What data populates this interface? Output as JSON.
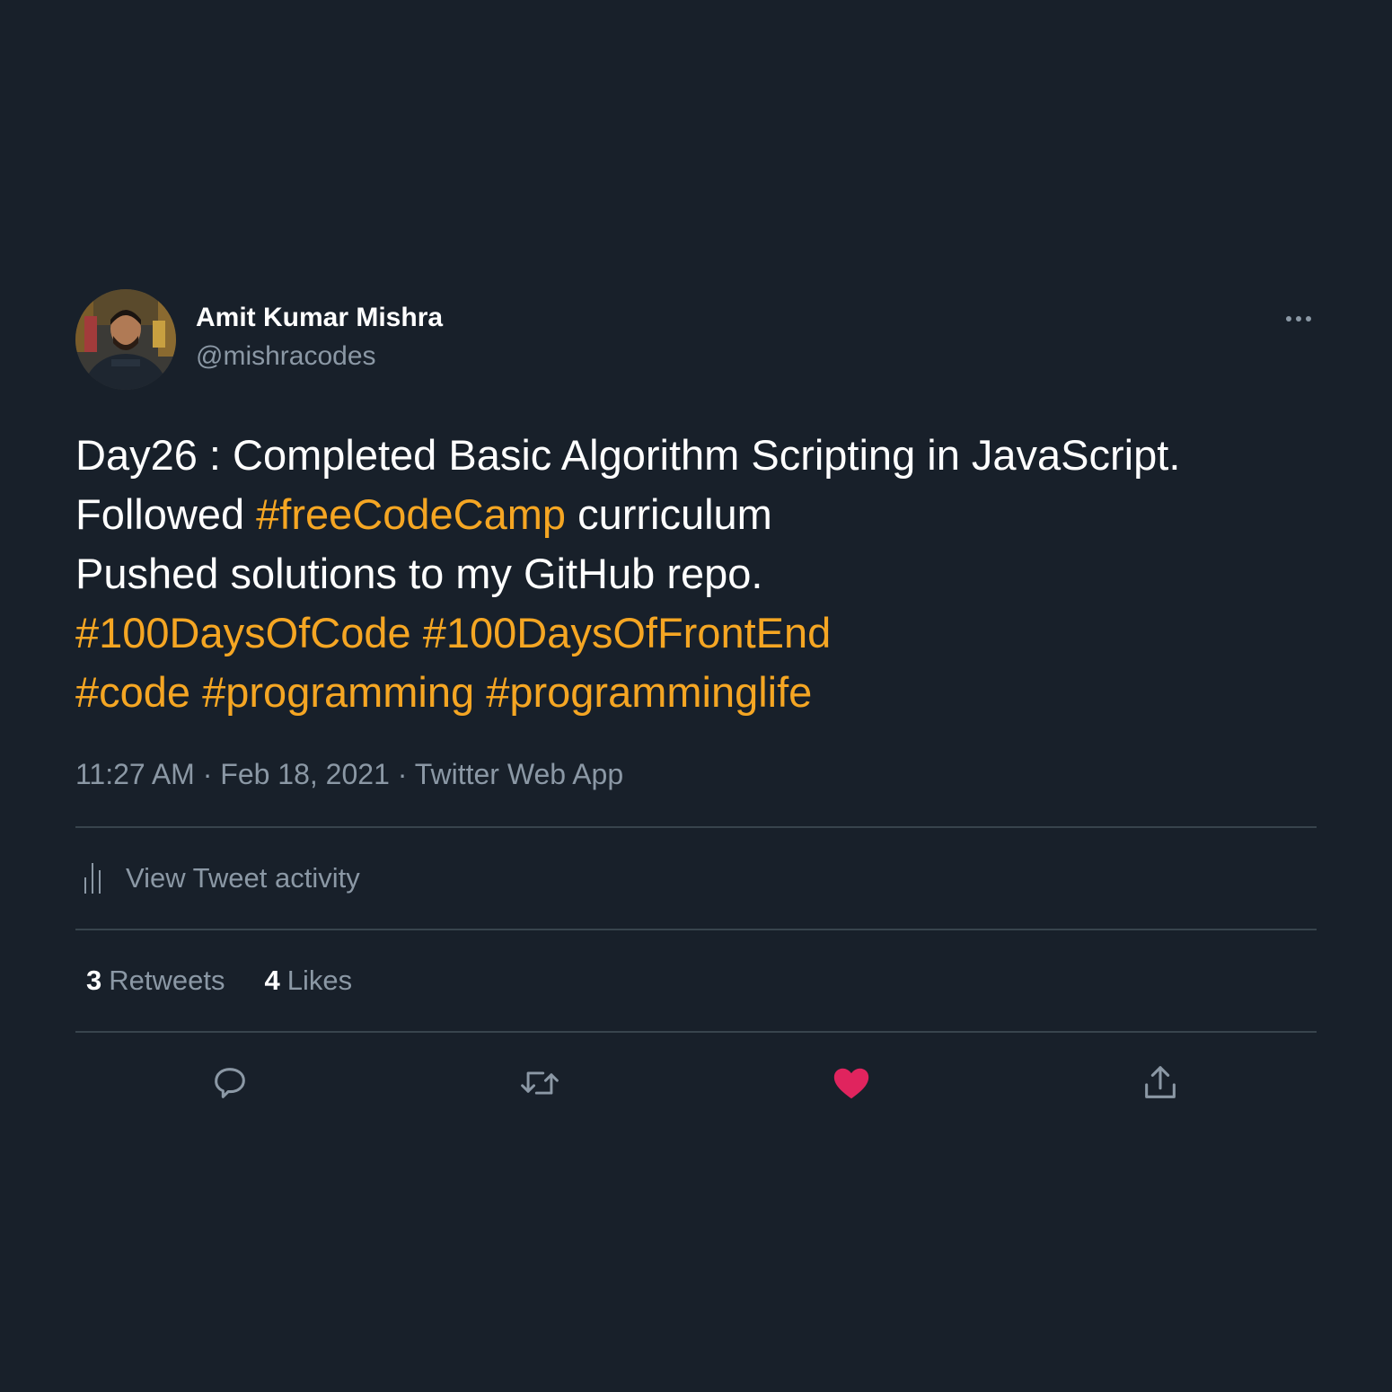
{
  "author": {
    "display_name": "Amit Kumar Mishra",
    "handle": "@mishracodes",
    "avatar_icon": "user-avatar-photo"
  },
  "tweet": {
    "line1": "Day26 : Completed Basic Algorithm Scripting in JavaScript.",
    "line2_text1": "Followed ",
    "line2_tag": "#freeCodeCamp",
    "line2_text2": " curriculum",
    "line3": "Pushed solutions to my GitHub repo.",
    "line4_tag1": "#100DaysOfCode",
    "line4_tag2": "#100DaysOfFrontEnd",
    "line5_tag1": "#code",
    "line5_tag2": "#programming",
    "line5_tag3": "#programminglife"
  },
  "meta": {
    "time": "11:27 AM",
    "separator": " · ",
    "date": "Feb 18, 2021",
    "app": "Twitter Web App"
  },
  "activity": {
    "label": "View Tweet activity",
    "icon": "analytics-bars-icon"
  },
  "stats": {
    "retweets_count": "3",
    "retweets_label": "Retweets",
    "likes_count": "4",
    "likes_label": "Likes"
  },
  "actions": {
    "reply_icon": "reply-icon",
    "retweet_icon": "retweet-icon",
    "like_icon": "heart-icon",
    "share_icon": "share-icon"
  },
  "colors": {
    "background": "#18202a",
    "hashtag": "#f5a623",
    "secondary_text": "#8b98a5",
    "divider": "#38444d",
    "liked_heart": "#e0245e"
  }
}
